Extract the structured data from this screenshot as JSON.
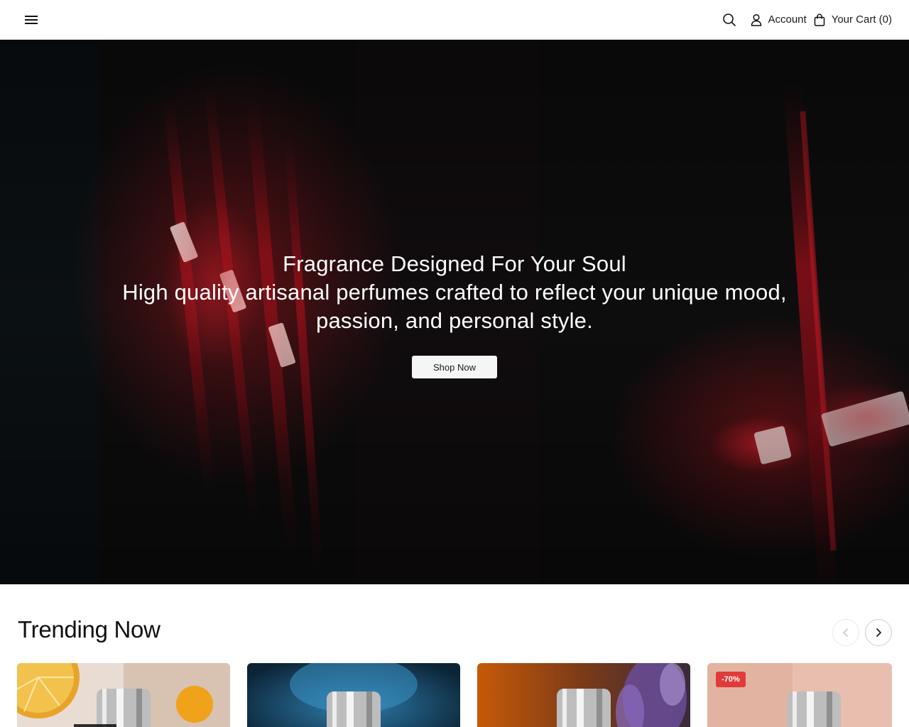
{
  "header": {
    "menu_icon": "hamburger-menu-icon",
    "search_icon": "search-icon",
    "account_icon": "user-icon",
    "account_label": "Account",
    "cart_icon": "shopping-bag-icon",
    "cart_label": "Your Cart (0)"
  },
  "hero": {
    "title": "Fragrance Designed For Your Soul",
    "subtitle": "High quality artisanal perfumes crafted to reflect your unique mood, passion, and personal style.",
    "cta_label": "Shop Now"
  },
  "trending": {
    "title": "Trending Now",
    "prev_icon": "chevron-left-icon",
    "next_icon": "chevron-right-icon",
    "products": [
      {
        "image": "perfume-bottle-citrus"
      },
      {
        "image": "perfume-bottle-blue"
      },
      {
        "image": "perfume-bottle-lavender"
      },
      {
        "image": "perfume-bottle-peach",
        "badge": "-70%"
      }
    ]
  },
  "colors": {
    "badge": "#e03b3b",
    "hero_accent": "#d9202a",
    "button_bg": "#f5f5f5"
  }
}
